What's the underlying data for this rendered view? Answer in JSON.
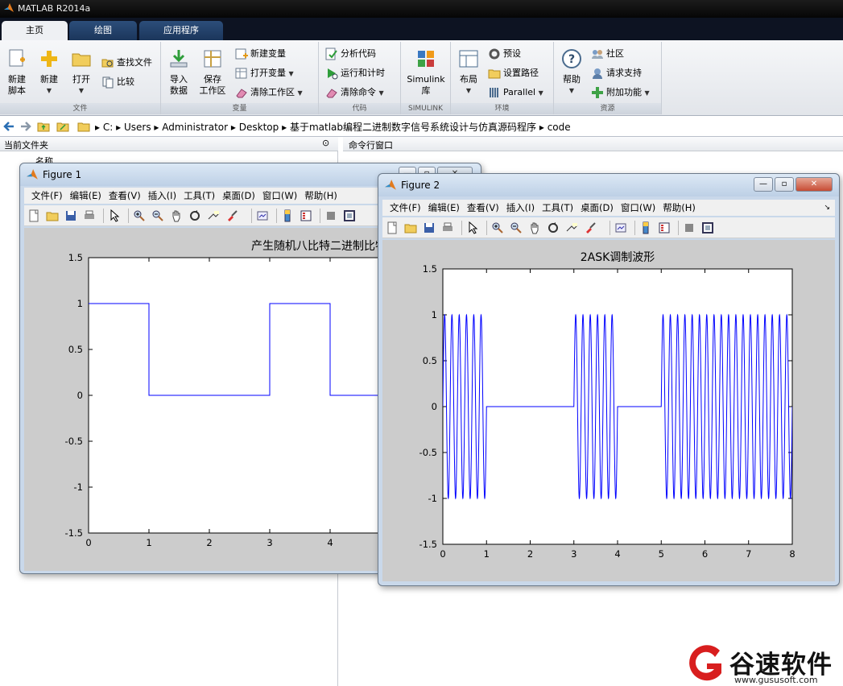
{
  "app": {
    "title": "MATLAB R2014a"
  },
  "tabs": [
    {
      "label": "主页"
    },
    {
      "label": "绘图"
    },
    {
      "label": "应用程序"
    }
  ],
  "ribbon": {
    "file": {
      "label": "文件",
      "new_script": "新建\n脚本",
      "new": "新建",
      "open": "打开",
      "find_files": "查找文件",
      "compare": "比较"
    },
    "variable": {
      "label": "变量",
      "import": "导入\n数据",
      "save_ws": "保存\n工作区",
      "new_var": "新建变量",
      "open_var": "打开变量",
      "clear_ws": "清除工作区"
    },
    "code": {
      "label": "代码",
      "analyze": "分析代码",
      "run_time": "运行和计时",
      "clear_cmd": "清除命令"
    },
    "simulink": {
      "label": "SIMULINK",
      "lib": "Simulink\n库"
    },
    "env": {
      "label": "环境",
      "layout": "布局",
      "prefs": "预设",
      "set_path": "设置路径",
      "parallel": "Parallel"
    },
    "resources": {
      "label": "资源",
      "help": "帮助",
      "community": "社区",
      "support": "请求支持",
      "addons": "附加功能"
    }
  },
  "address": {
    "path": [
      "C:",
      "Users",
      "Administrator",
      "Desktop",
      "基于matlab编程二进制数字信号系统设计与仿真源码程序",
      "code"
    ]
  },
  "panels": {
    "current_folder": "当前文件夹",
    "name_col": "名称",
    "command_window": "命令行窗口"
  },
  "figure_menu": [
    "文件(F)",
    "编辑(E)",
    "查看(V)",
    "插入(I)",
    "工具(T)",
    "桌面(D)",
    "窗口(W)",
    "帮助(H)"
  ],
  "figure1": {
    "title": "Figure 1",
    "chart_data": {
      "type": "line",
      "title": "产生随机八比特二进制比特序列",
      "xlabel": "",
      "ylabel": "",
      "xlim": [
        0,
        8
      ],
      "ylim": [
        -1.5,
        1.5
      ],
      "xticks": [
        "0",
        "1",
        "2",
        "3",
        "4",
        "5",
        "6"
      ],
      "yticks": [
        "-1.5",
        "-1",
        "-0.5",
        "0",
        "0.5",
        "1",
        "1.5"
      ],
      "bits": [
        1,
        0,
        0,
        1,
        0,
        1,
        1,
        1
      ],
      "color": "#0000ff",
      "grid": false
    }
  },
  "figure2": {
    "title": "Figure 2",
    "chart_data": {
      "type": "line",
      "title": "2ASK调制波形",
      "xlabel": "",
      "ylabel": "",
      "xlim": [
        0,
        8
      ],
      "ylim": [
        -1.5,
        1.5
      ],
      "xticks": [
        "0",
        "1",
        "2",
        "3",
        "4",
        "5",
        "6",
        "7",
        "8"
      ],
      "yticks": [
        "-1.5",
        "-1",
        "-0.5",
        "0",
        "0.5",
        "1",
        "1.5"
      ],
      "bits": [
        1,
        0,
        0,
        1,
        0,
        1,
        1,
        1
      ],
      "cycles_per_bit": 6,
      "amplitude": 1,
      "color": "#0000ff",
      "grid": false
    }
  },
  "watermark": {
    "brand": "谷速软件",
    "url": "www.gususoft.com"
  }
}
